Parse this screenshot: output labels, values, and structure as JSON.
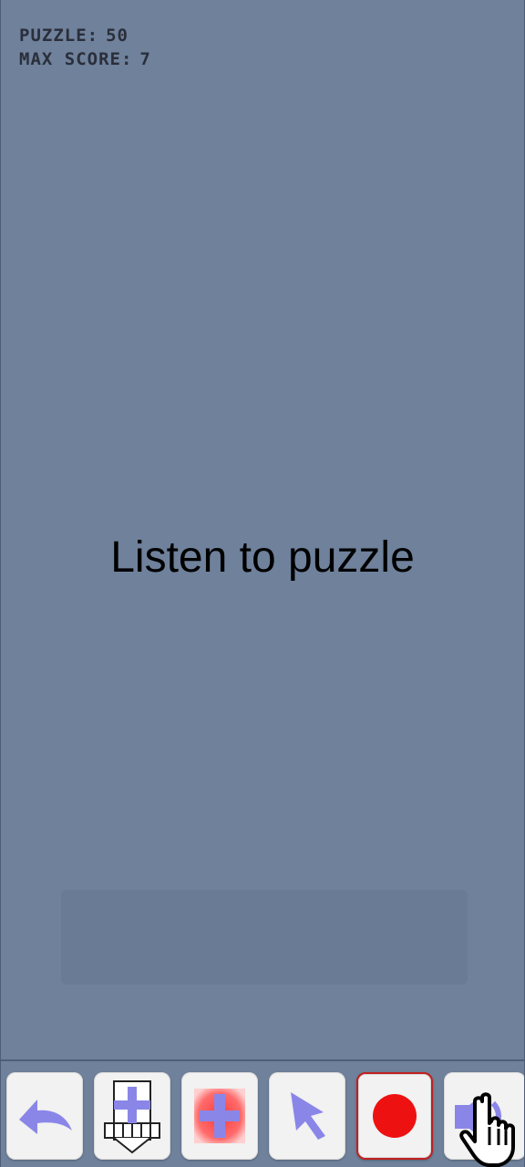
{
  "hud": {
    "puzzle_label": "PUZZLE:",
    "puzzle_value": "50",
    "max_score_label": "MAX SCORE:",
    "max_score_value": "7"
  },
  "message": {
    "text": "Listen to puzzle"
  },
  "toolbar": {
    "buttons": [
      {
        "name": "undo",
        "icon": "undo-arrow-icon"
      },
      {
        "name": "add-note",
        "icon": "keyboard-plus-icon"
      },
      {
        "name": "add",
        "icon": "plus-icon"
      },
      {
        "name": "select",
        "icon": "cursor-arrow-icon"
      },
      {
        "name": "record",
        "icon": "record-dot-icon"
      },
      {
        "name": "speaker",
        "icon": "speaker-icon"
      }
    ]
  },
  "colors": {
    "background": "#6f819b",
    "accent": "#8a86e8",
    "record": "#ee1111"
  }
}
